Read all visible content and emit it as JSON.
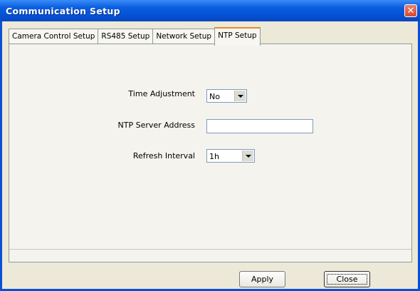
{
  "window": {
    "title": "Communication Setup"
  },
  "tabs": [
    {
      "label": "Camera Control Setup",
      "active": false
    },
    {
      "label": "RS485 Setup",
      "active": false
    },
    {
      "label": "Network Setup",
      "active": false
    },
    {
      "label": "NTP Setup",
      "active": true
    }
  ],
  "form": {
    "time_adjustment": {
      "label": "Time Adjustment",
      "value": "No"
    },
    "ntp_server": {
      "label": "NTP Server Address",
      "value": ""
    },
    "refresh_interval": {
      "label": "Refresh Interval",
      "value": "1h"
    }
  },
  "buttons": {
    "apply": "Apply",
    "close": "Close"
  },
  "icons": {
    "window_close": "close-icon",
    "dropdown": "chevron-down-icon"
  }
}
